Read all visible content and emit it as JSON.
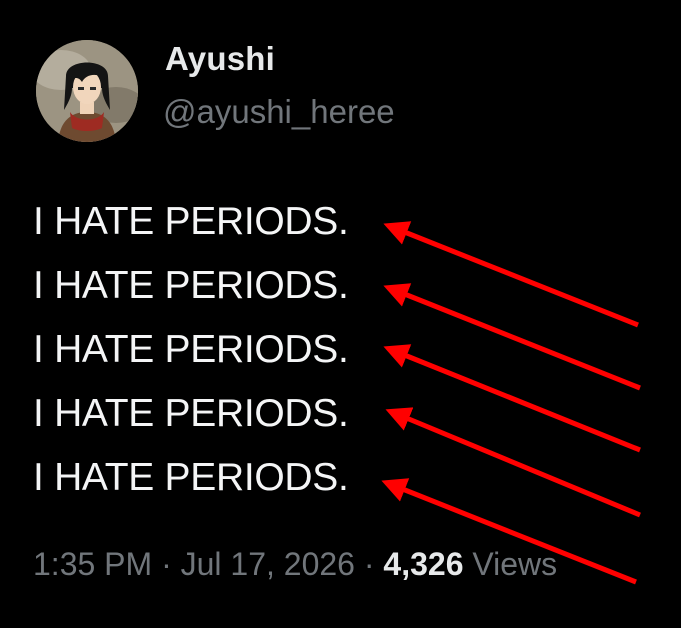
{
  "tweet": {
    "author": {
      "display_name": "Ayushi",
      "handle": "@ayushi_heree",
      "avatar_icon": "anime-character-avatar"
    },
    "lines": [
      "I HATE PERIODS.",
      "I HATE PERIODS.",
      "I HATE PERIODS.",
      "I HATE PERIODS.",
      "I HATE PERIODS."
    ],
    "meta": {
      "time": "1:35 PM",
      "separator": "·",
      "date": "Jul 17, 2026",
      "views_count": "4,326",
      "views_label": "Views"
    }
  },
  "annotation": {
    "arrow_color": "#ff0000",
    "arrow_icon": "red-arrow-icon"
  }
}
